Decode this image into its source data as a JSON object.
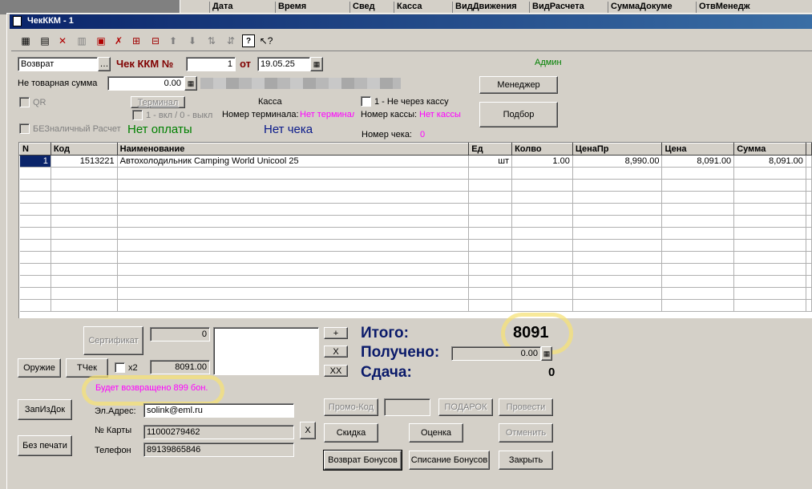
{
  "window": {
    "title": "ЧекККМ - 1"
  },
  "background_header": [
    "Дата",
    "Время",
    "Свед",
    "Касса",
    "ВидДвижения",
    "ВидРасчета",
    "СуммаДокуме",
    "ОтвМенедж"
  ],
  "form": {
    "operation": "Возврат",
    "check_label": "Чек ККМ №",
    "check_number": "1",
    "date_label": "от",
    "date": "19.05.25",
    "user": "Админ",
    "nontovar_label": "Не товарная сумма",
    "nontovar_value": "0.00",
    "qr_label": "QR",
    "terminal_button": "Терминал",
    "terminal_toggle_label": "1 - вкл / 0 - выкл",
    "cashless_label": "БЕЗналичный Расчет",
    "kassa_label": "Касса",
    "terminal_number_label": "Номер терминала:",
    "terminal_number_value": "Нет терминала",
    "not_via_kassa_label": "1 - Не через кассу",
    "kassa_number_label": "Номер кассы:",
    "kassa_number_value": "Нет кассы",
    "check_number_label": "Номер чека:",
    "check_number_value": "0",
    "no_payment": "Нет оплаты",
    "no_check": "Нет чека",
    "manager_button": "Менеджер",
    "selection_button": "Подбор"
  },
  "table": {
    "columns": [
      "N",
      "Код",
      "Наименование",
      "Ед",
      "Колво",
      "ЦенаПр",
      "Цена",
      "Сумма"
    ],
    "rows": [
      {
        "n": "1",
        "code": "1513221",
        "name": "Автохолодильник Camping World Unicool 25",
        "unit": "шт",
        "qty": "1.00",
        "price_pr": "8,990.00",
        "price": "8,091.00",
        "sum": "8,091.00"
      }
    ]
  },
  "bottom": {
    "certificate_button": "Сертификат",
    "certificate_value": "0",
    "weapon_button": "Оружие",
    "tcheck_button": "ТЧек",
    "x2_label": "x2",
    "amount_value": "8091.00",
    "bonus_message": "Будет возвращено 899 бон.",
    "plus_button": "+",
    "x_button": "X",
    "xx_button": "XX",
    "total_label": "Итого:",
    "total_value": "8091",
    "received_label": "Получено:",
    "received_value": "0.00",
    "change_label": "Сдача:",
    "change_value": "0",
    "zapizdok_button": "ЗапИзДок",
    "noprint_button": "Без печати",
    "email_label": "Эл.Адрес:",
    "email_value": "solink@eml.ru",
    "card_label": "№ Карты",
    "card_value": "11000279462",
    "phone_label": "Телефон",
    "phone_value": "89139865846",
    "clear_button": "X",
    "promo_button": "Промо-Код",
    "gift_button": "ПОДАРОК",
    "post_button": "Провести",
    "discount_button": "Скидка",
    "rating_button": "Оценка",
    "cancel_button": "Отменить",
    "return_bonus_button": "Возврат Бонусов",
    "writeoff_bonus_button": "Списание Бонусов",
    "close_button": "Закрыть"
  },
  "colors": {
    "title_bar": "#0a246a",
    "no_payment": "#008000",
    "no_check": "#0a1a8a",
    "magenta": "#ff00ff",
    "dark_red": "#800000",
    "highlight": "#f5e178"
  }
}
